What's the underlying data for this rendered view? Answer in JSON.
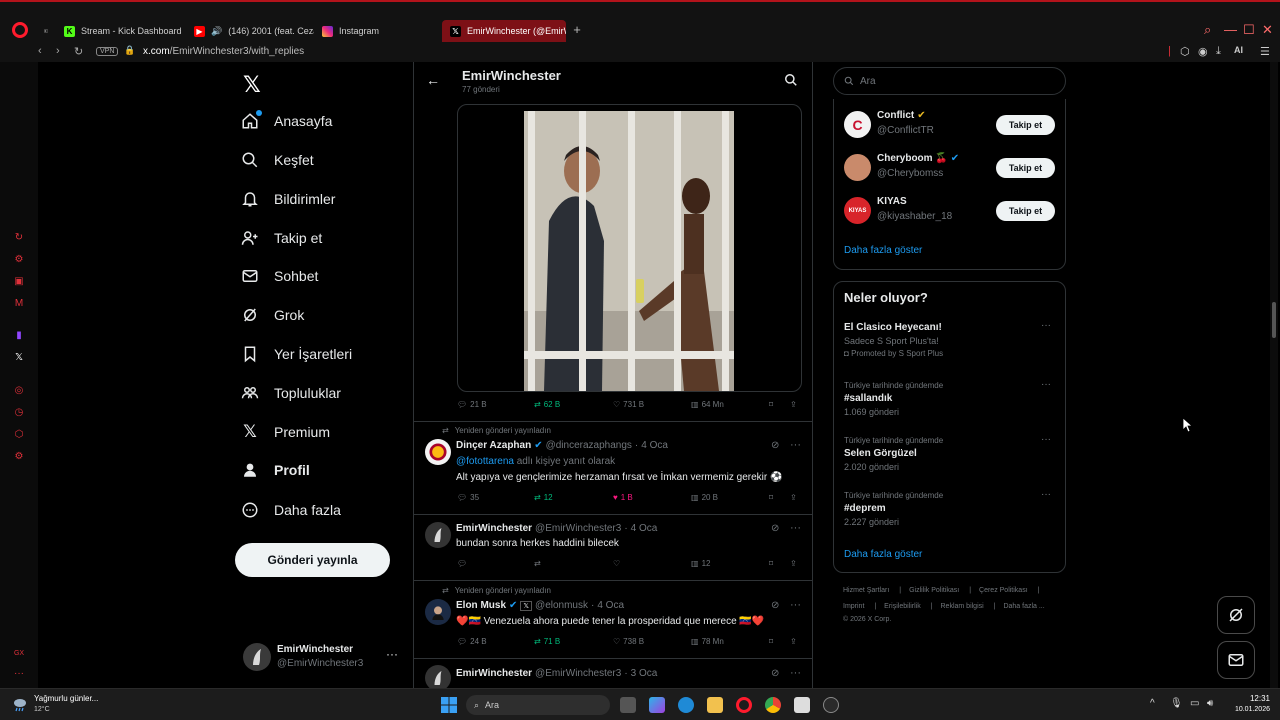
{
  "browser": {
    "tabs": [
      {
        "label": "Stream - Kick Dashboard",
        "icon": "kick-icon",
        "color": "#53fc18"
      },
      {
        "label": "(146) 2001 (feat. Ceza",
        "icon": "youtube-icon",
        "color": "#ff0000"
      },
      {
        "label": "Instagram",
        "icon": "instagram-icon",
        "color": "#e1306c"
      },
      {
        "label": "EmirWinchester (@EmirW",
        "icon": "x-icon",
        "color": "#000000"
      }
    ],
    "vpn_label": "VPN",
    "url_host": "x.com",
    "url_path": "/EmirWinchester3/with_replies",
    "ai_label": "AI"
  },
  "nav": {
    "items": [
      {
        "label": "Anasayfa",
        "icon": "home-icon"
      },
      {
        "label": "Keşfet",
        "icon": "search-icon"
      },
      {
        "label": "Bildirimler",
        "icon": "bell-icon"
      },
      {
        "label": "Takip et",
        "icon": "add-user-icon"
      },
      {
        "label": "Sohbet",
        "icon": "mail-icon"
      },
      {
        "label": "Grok",
        "icon": "grok-icon"
      },
      {
        "label": "Yer İşaretleri",
        "icon": "bookmark-icon"
      },
      {
        "label": "Topluluklar",
        "icon": "communities-icon"
      },
      {
        "label": "Premium",
        "icon": "x-icon"
      },
      {
        "label": "Profil",
        "icon": "user-icon"
      },
      {
        "label": "Daha fazla",
        "icon": "more-circle-icon"
      }
    ],
    "post_button": "Gönderi yayınla",
    "account": {
      "name": "EmirWinchester",
      "handle": "@EmirWinchester3"
    }
  },
  "profile_header": {
    "name": "EmirWinchester",
    "posts": "77 gönderi"
  },
  "media_post_actions": {
    "replies": "21 B",
    "reposts": "62 B",
    "likes": "731 B",
    "views": "64 Mn"
  },
  "tweets": [
    {
      "repost_note": "Yeniden gönderi yayınladın",
      "name": "Dinçer Azaphan",
      "handle": "@dincerazaphangs",
      "date": "4 Oca",
      "reply_to_user": "@fotottarena",
      "reply_suffix": "adlı kişiye yanıt olarak",
      "text": "Alt yapıya ve gençlerimize herzaman fırsat ve İmkan vermemiz gerekir ⚽",
      "replies": "35",
      "reposts": "12",
      "likes": "1 B",
      "views": "20 B"
    },
    {
      "name": "EmirWinchester",
      "handle": "@EmirWinchester3",
      "date": "4 Oca",
      "text": "bundan sonra herkes haddini bilecek",
      "replies": "",
      "reposts": "",
      "likes": "",
      "views": "12"
    },
    {
      "repost_note": "Yeniden gönderi yayınladın",
      "name": "Elon Musk",
      "handle": "@elonmusk",
      "date": "4 Oca",
      "text": "❤️🇻🇪 Venezuela ahora puede tener la prosperidad que merece 🇻🇪❤️",
      "replies": "24 B",
      "reposts": "71 B",
      "likes": "738 B",
      "views": "78 Mn"
    },
    {
      "name": "EmirWinchester",
      "handle": "@EmirWinchester3",
      "date": "3 Oca"
    }
  ],
  "right": {
    "search_placeholder": "Ara",
    "follow_suggestions": [
      {
        "name": "Conflict",
        "handle": "@ConflictTR",
        "button": "Takip et",
        "avatar_color": "#f2f2f2"
      },
      {
        "name": "Cheryboom 🍒",
        "handle": "@Cherybomss",
        "button": "Takip et",
        "avatar_color": "#c98a6b"
      },
      {
        "name": "KIYAS",
        "handle": "@kiyashaber_18",
        "button": "Takip et",
        "avatar_color": "#d8242a"
      }
    ],
    "show_more": "Daha fazla göster",
    "trends_title": "Neler oluyor?",
    "trends": [
      {
        "context": "",
        "name": "El Clasico Heyecanı!",
        "sub": "Sadece S Sport Plus'ta!",
        "promo": "Promoted by S Sport Plus"
      },
      {
        "context": "Türkiye tarihinde gündemde",
        "name": "#sallandık",
        "sub": "1.069 gönderi"
      },
      {
        "context": "Türkiye tarihinde gündemde",
        "name": "Selen Görgüzel",
        "sub": "2.020 gönderi"
      },
      {
        "context": "Türkiye tarihinde gündemde",
        "name": "#deprem",
        "sub": "2.227 gönderi"
      }
    ],
    "trends_more": "Daha fazla göster",
    "footer_line1": [
      "Hizmet Şartları",
      "Gizlilik Politikası",
      "Çerez Politikası"
    ],
    "footer_line2": [
      "Imprint",
      "Erişilebilirlik",
      "Reklam bilgisi",
      "Daha fazla ..."
    ],
    "copyright": "© 2026 X Corp."
  },
  "taskbar": {
    "weather_title": "Yağmurlu günler...",
    "weather_temp": "12°C",
    "search_placeholder": "Ara",
    "time": "12:31",
    "date": "10.01.2026"
  }
}
